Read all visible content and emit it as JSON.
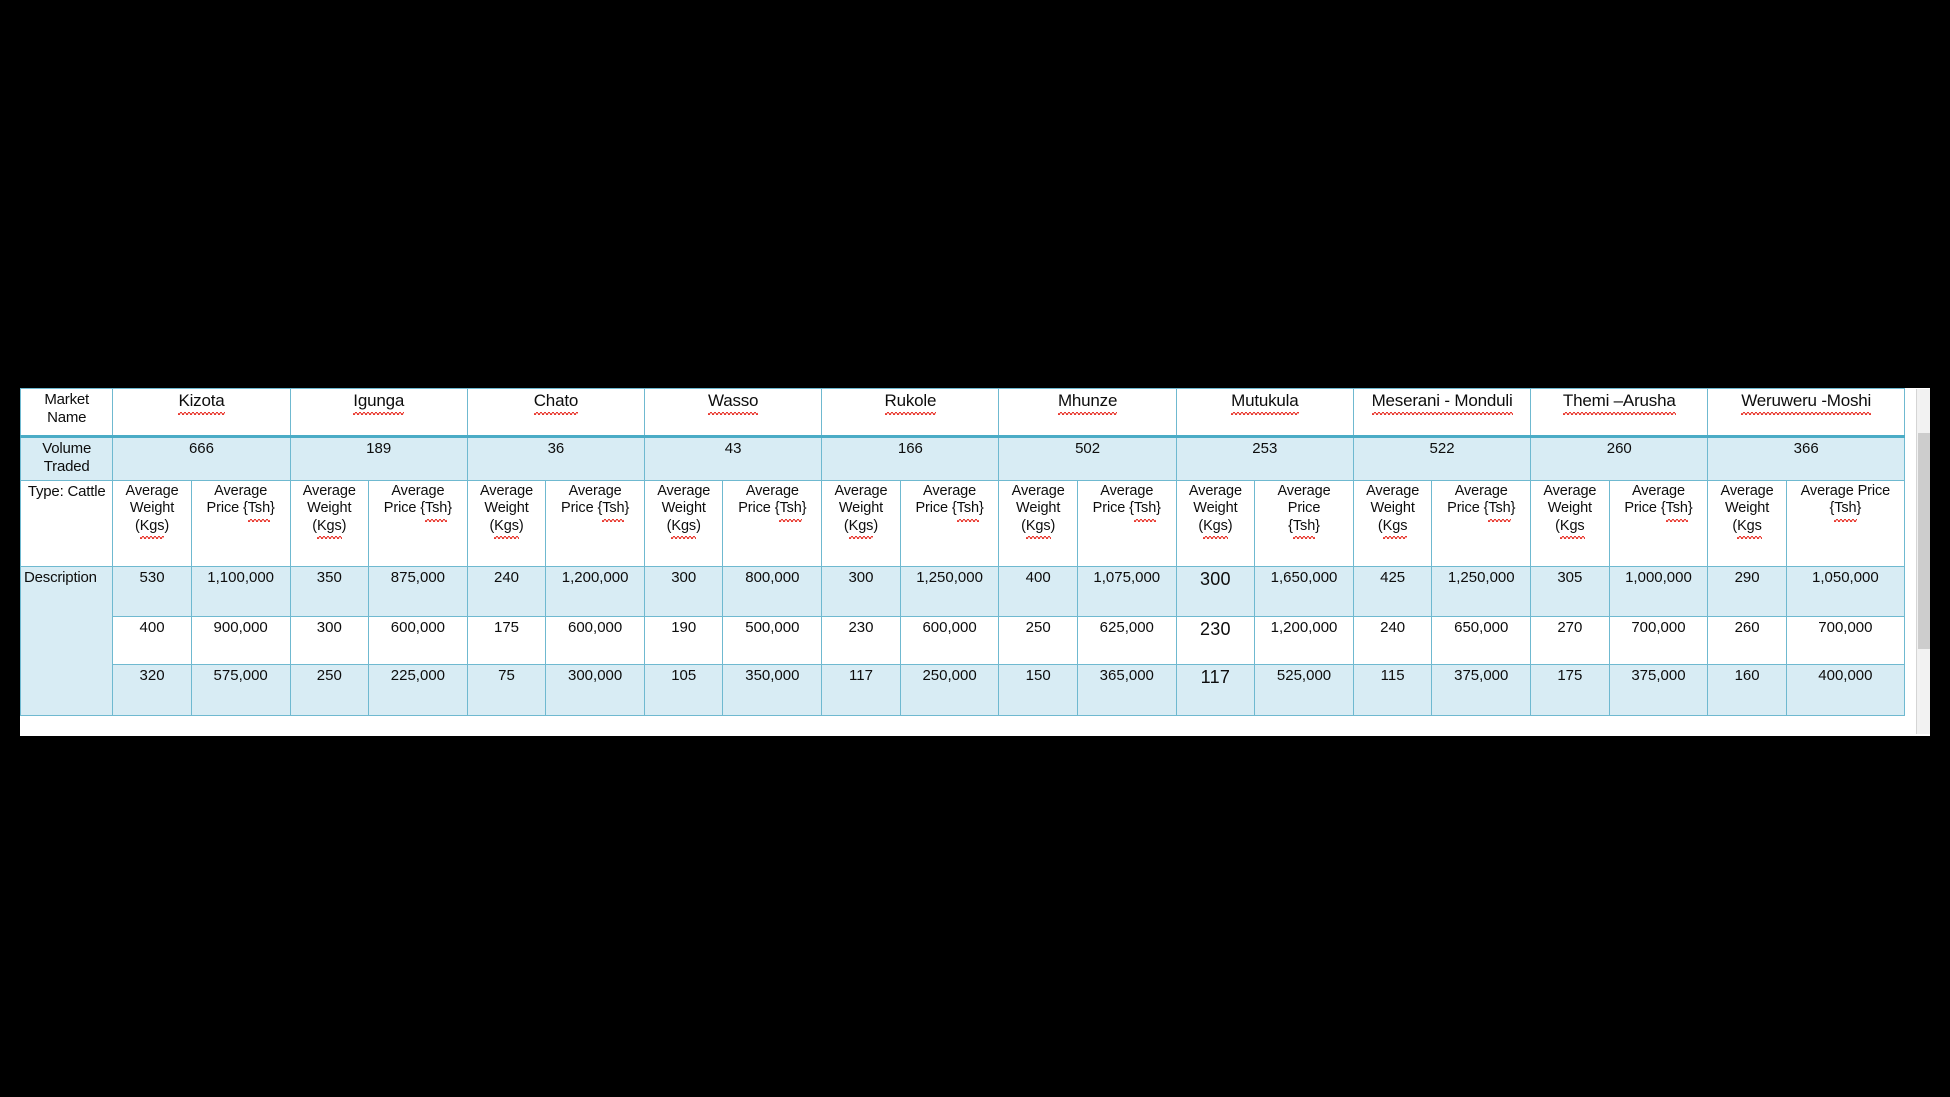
{
  "table": {
    "row_labels": {
      "market_name": "Market\nName",
      "volume_traded": "Volume\nTraded",
      "type": "Type: Cattle",
      "description": "Description"
    },
    "subheaders": {
      "weight": "Average\nWeight\n(Kgs)",
      "weight_nocloser": "Average\nWeight\n(Kgs",
      "price": "Average\nPrice {Tsh}",
      "price_stacked": "Average\nPrice\n{Tsh}",
      "price_wrapped": "Average Price\n{Tsh}"
    },
    "colors": {
      "band_fill": "#d8ecf4",
      "accent_rule": "#4bacc6",
      "grid_line": "#6fb9d0",
      "text": "#0d0d0d",
      "spellcheck_underline": "#e8392f",
      "page_background": "#000000",
      "scroll_track": "#f2f2f2",
      "scroll_thumb": "#cdcdcd"
    },
    "markets": [
      {
        "name": "Kizota",
        "volume": "666",
        "weight_header": "Average\nWeight\n(Kgs)",
        "price_header": "Average\nPrice {Tsh}",
        "rows": [
          {
            "weight": "530",
            "price": "1,100,000"
          },
          {
            "weight": "400",
            "price": "900,000"
          },
          {
            "weight": "320",
            "price": "575,000"
          }
        ]
      },
      {
        "name": "Igunga",
        "volume": "189",
        "weight_header": "Average\nWeight\n(Kgs)",
        "price_header": "Average\nPrice {Tsh}",
        "rows": [
          {
            "weight": "350",
            "price": "875,000"
          },
          {
            "weight": "300",
            "price": "600,000"
          },
          {
            "weight": "250",
            "price": "225,000"
          }
        ]
      },
      {
        "name": "Chato",
        "volume": "36",
        "weight_header": "Average\nWeight\n(Kgs)",
        "price_header": "Average\nPrice {Tsh}",
        "rows": [
          {
            "weight": "240",
            "price": "1,200,000"
          },
          {
            "weight": "175",
            "price": "600,000"
          },
          {
            "weight": "75",
            "price": "300,000"
          }
        ]
      },
      {
        "name": "Wasso",
        "volume": "43",
        "weight_header": "Average\nWeight\n(Kgs)",
        "price_header": "Average\nPrice {Tsh}",
        "rows": [
          {
            "weight": "300",
            "price": "800,000"
          },
          {
            "weight": "190",
            "price": "500,000"
          },
          {
            "weight": "105",
            "price": "350,000"
          }
        ]
      },
      {
        "name": "Rukole",
        "volume": "166",
        "weight_header": "Average\nWeight\n(Kgs)",
        "price_header": "Average\nPrice {Tsh}",
        "rows": [
          {
            "weight": "300",
            "price": "1,250,000"
          },
          {
            "weight": "230",
            "price": "600,000"
          },
          {
            "weight": "117",
            "price": "250,000"
          }
        ]
      },
      {
        "name": "Mhunze",
        "volume": "502",
        "weight_header": "Average\nWeight\n(Kgs)",
        "price_header": "Average\nPrice {Tsh}",
        "rows": [
          {
            "weight": "400",
            "price": "1,075,000"
          },
          {
            "weight": "250",
            "price": "625,000"
          },
          {
            "weight": "150",
            "price": "365,000"
          }
        ]
      },
      {
        "name": "Mutukula",
        "volume": "253",
        "weight_header": "Average\nWeight\n(Kgs)",
        "price_header": "Average\nPrice\n{Tsh}",
        "rows": [
          {
            "weight": "300",
            "price": "1,650,000"
          },
          {
            "weight": "230",
            "price": "1,200,000"
          },
          {
            "weight": "117",
            "price": "525,000"
          }
        ]
      },
      {
        "name": "Meserani - Monduli",
        "volume": "522",
        "weight_header": "Average\nWeight\n(Kgs",
        "price_header": "Average\nPrice {Tsh}",
        "rows": [
          {
            "weight": "425",
            "price": "1,250,000"
          },
          {
            "weight": "240",
            "price": "650,000"
          },
          {
            "weight": "115",
            "price": "375,000"
          }
        ]
      },
      {
        "name": "Themi –Arusha",
        "volume": "260",
        "weight_header": "Average\nWeight\n(Kgs",
        "price_header": "Average\nPrice {Tsh}",
        "rows": [
          {
            "weight": "305",
            "price": "1,000,000"
          },
          {
            "weight": "270",
            "price": "700,000"
          },
          {
            "weight": "175",
            "price": "375,000"
          }
        ]
      },
      {
        "name": "Weruweru -Moshi",
        "volume": "366",
        "weight_header": "Average\nWeight\n(Kgs",
        "price_header": "Average Price\n{Tsh}",
        "rows": [
          {
            "weight": "290",
            "price": "1,050,000"
          },
          {
            "weight": "260",
            "price": "700,000"
          },
          {
            "weight": "160",
            "price": "400,000"
          }
        ]
      }
    ]
  }
}
